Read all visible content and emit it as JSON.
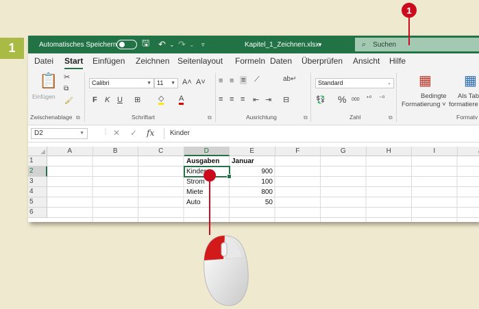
{
  "step_number": "1",
  "callout_number": "1",
  "titlebar": {
    "autosave_label": "Automatisches Speichern",
    "filename": "Kapitel_1_Zeichnen.xlsx",
    "search_placeholder": "Suchen"
  },
  "tabs": [
    "Datei",
    "Start",
    "Einfügen",
    "Zeichnen",
    "Seitenlayout",
    "Formeln",
    "Daten",
    "Überprüfen",
    "Ansicht",
    "Hilfe"
  ],
  "active_tab": "Start",
  "ribbon": {
    "paste_label": "Einfügen",
    "font_name": "Calibri",
    "font_size": "11",
    "grow_font": "A˄",
    "shrink_font": "A˅",
    "bold": "F",
    "italic": "K",
    "underline": "U",
    "number_format": "Standard",
    "percent": "%",
    "thousands": "000",
    "cond_format_line1": "Bedingte",
    "cond_format_line2": "Formatierung ˅",
    "table_format_line1": "Als Tabe",
    "table_format_line2": "formatiere",
    "groups": {
      "clipboard": "Zwischenablage",
      "font": "Schriftart",
      "alignment": "Ausrichtung",
      "number": "Zahl",
      "styles": "Formatv"
    }
  },
  "formula_bar": {
    "name_box": "D2",
    "cancel": "✕",
    "enter": "✓",
    "fx": "fx",
    "value": "Kinder"
  },
  "columns": [
    "A",
    "B",
    "C",
    "D",
    "E",
    "F",
    "G",
    "H",
    "I",
    "J"
  ],
  "selected_column": "D",
  "rows": [
    "1",
    "2",
    "3",
    "4",
    "5",
    "6"
  ],
  "selected_row": "2",
  "cells": {
    "D1": "Ausgaben",
    "E1": "Januar",
    "D2": "Kinder",
    "E2": "900",
    "D3": "Strom",
    "E3": "100",
    "D4": "Miete",
    "E4": "800",
    "D5": "Auto",
    "E5": "50"
  },
  "colors": {
    "excel_green": "#217346",
    "callout_red": "#cc0a1e",
    "step_badge": "#aabb45",
    "page_background": "#efe9cf"
  }
}
